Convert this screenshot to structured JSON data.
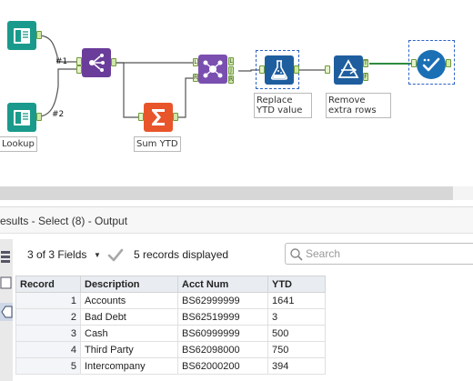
{
  "workflow": {
    "lookup_label": "Lookup",
    "connection_1": "#1",
    "connection_2": "#2",
    "sum_ytd_label": "Sum YTD",
    "replace_ytd_label": "Replace YTD value",
    "remove_rows_label": "Remove extra rows",
    "join_anchors": {
      "left": "L",
      "right": "R",
      "out_left": "L",
      "out_join": "J",
      "out_right": "R"
    },
    "filter_anchors": {
      "true": "T",
      "false": "F"
    }
  },
  "results": {
    "title": "esults - Select (8) - Output",
    "fields_label": "3 of 3 Fields",
    "records_label": "5 records displayed",
    "search_placeholder": "Search",
    "columns": [
      "Record",
      "Description",
      "Acct Num",
      "YTD"
    ],
    "rows": [
      {
        "record": "1",
        "description": "Accounts",
        "acct_num": "BS62999999",
        "ytd": "1641"
      },
      {
        "record": "2",
        "description": "Bad Debt",
        "acct_num": "BS62519999",
        "ytd": "3"
      },
      {
        "record": "3",
        "description": "Cash",
        "acct_num": "BS60999999",
        "ytd": "500"
      },
      {
        "record": "4",
        "description": "Third Party",
        "acct_num": "BS62098000",
        "ytd": "750"
      },
      {
        "record": "5",
        "description": "Intercompany",
        "acct_num": "BS62000200",
        "ytd": "394"
      }
    ]
  },
  "icons": [
    "input-book-icon",
    "append-fields-icon",
    "summarize-sigma-icon",
    "join-icon",
    "formula-flask-icon",
    "filter-icon",
    "select-check-icon",
    "check-icon",
    "search-icon"
  ],
  "colors": {
    "input_teal": "#1a9a8c",
    "append_purple": "#6a3d9a",
    "summarize_orange": "#e8552a",
    "join_purple": "#7a4fb0",
    "formula_blue": "#1f5e9e",
    "filter_blue": "#1f5e9e",
    "select_blue": "#1b6fb5",
    "wire_green": "#2e8b3f"
  }
}
